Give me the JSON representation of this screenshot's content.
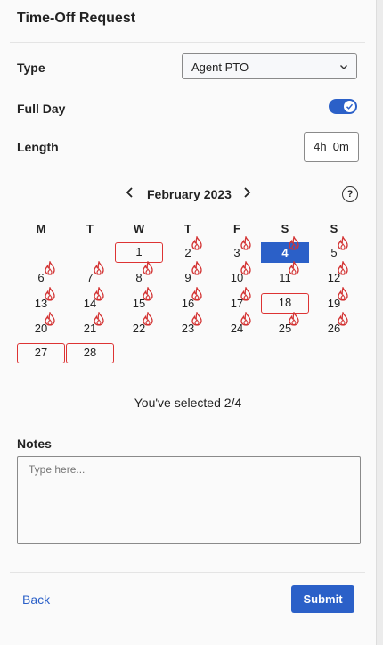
{
  "header": {
    "title": "Time-Off Request"
  },
  "form": {
    "type_label": "Type",
    "type_value": "Agent PTO",
    "fullday_label": "Full Day",
    "fullday_on": true,
    "length_label": "Length",
    "length_value": "4h  0m"
  },
  "calendar": {
    "month_label": "February 2023",
    "weekdays": [
      "M",
      "T",
      "W",
      "T",
      "F",
      "S",
      "S"
    ],
    "days": [
      {
        "d": "1",
        "style": "outlined",
        "flame": false
      },
      {
        "d": "2",
        "style": "",
        "flame": true
      },
      {
        "d": "3",
        "style": "",
        "flame": true
      },
      {
        "d": "4",
        "style": "selected",
        "flame": true
      },
      {
        "d": "5",
        "style": "",
        "flame": true
      },
      {
        "d": "6",
        "style": "",
        "flame": true
      },
      {
        "d": "7",
        "style": "",
        "flame": true
      },
      {
        "d": "8",
        "style": "",
        "flame": true
      },
      {
        "d": "9",
        "style": "",
        "flame": true
      },
      {
        "d": "10",
        "style": "",
        "flame": true
      },
      {
        "d": "11",
        "style": "",
        "flame": true
      },
      {
        "d": "12",
        "style": "",
        "flame": true
      },
      {
        "d": "13",
        "style": "",
        "flame": true
      },
      {
        "d": "14",
        "style": "",
        "flame": true
      },
      {
        "d": "15",
        "style": "",
        "flame": true
      },
      {
        "d": "16",
        "style": "",
        "flame": true
      },
      {
        "d": "17",
        "style": "",
        "flame": true
      },
      {
        "d": "18",
        "style": "outlined",
        "flame": false
      },
      {
        "d": "19",
        "style": "",
        "flame": true
      },
      {
        "d": "20",
        "style": "",
        "flame": true
      },
      {
        "d": "21",
        "style": "",
        "flame": true
      },
      {
        "d": "22",
        "style": "",
        "flame": true
      },
      {
        "d": "23",
        "style": "",
        "flame": true
      },
      {
        "d": "24",
        "style": "",
        "flame": true
      },
      {
        "d": "25",
        "style": "",
        "flame": true
      },
      {
        "d": "26",
        "style": "",
        "flame": true
      },
      {
        "d": "27",
        "style": "outlined",
        "flame": false
      },
      {
        "d": "28",
        "style": "outlined",
        "flame": false
      }
    ],
    "first_weekday_index": 2,
    "help_symbol": "?"
  },
  "summary": {
    "text": "You've selected 2/4"
  },
  "notes": {
    "label": "Notes",
    "placeholder": "Type here..."
  },
  "footer": {
    "back_label": "Back",
    "submit_label": "Submit"
  },
  "colors": {
    "accent": "#2b60c8",
    "flame": "#d33333",
    "outline": "#d33333"
  }
}
